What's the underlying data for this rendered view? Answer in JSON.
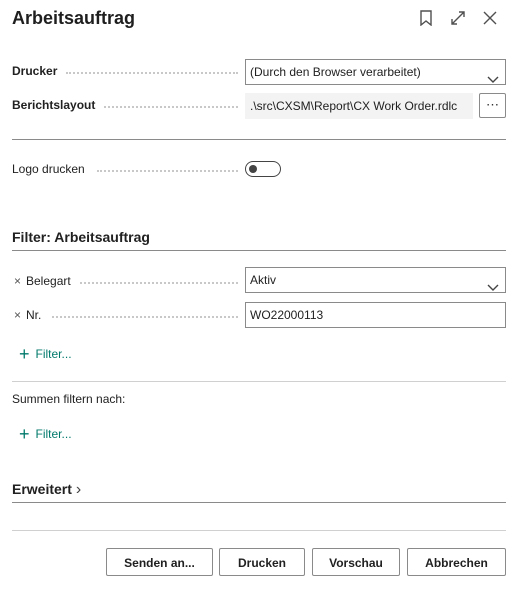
{
  "dialog": {
    "title": "Arbeitsauftrag"
  },
  "printer": {
    "label": "Drucker",
    "value": "(Durch den Browser verarbeitet)"
  },
  "layout": {
    "label": "Berichtslayout",
    "value": ".\\src\\CXSM\\Report\\CX Work Order.rdlc",
    "more": "⋯"
  },
  "logo": {
    "label": "Logo drucken",
    "enabled": false
  },
  "filter_section": {
    "title": "Filter: Arbeitsauftrag"
  },
  "filters": [
    {
      "remove": "×",
      "label": "Belegart",
      "value": "Aktiv"
    },
    {
      "remove": "×",
      "label": "Nr.",
      "value": "WO22000113"
    }
  ],
  "add_filter": {
    "plus": "+",
    "label": "Filter..."
  },
  "totals": {
    "label": "Summen filtern nach:",
    "add_label": "Filter...",
    "plus": "+"
  },
  "advanced": {
    "label": "Erweitert",
    "chevron": "›"
  },
  "buttons": {
    "send": "Senden an...",
    "print": "Drucken",
    "preview": "Vorschau",
    "cancel": "Abbrechen"
  },
  "icons": {
    "bookmark": "bookmark-icon",
    "expand": "expand-icon",
    "close": "close-icon"
  }
}
